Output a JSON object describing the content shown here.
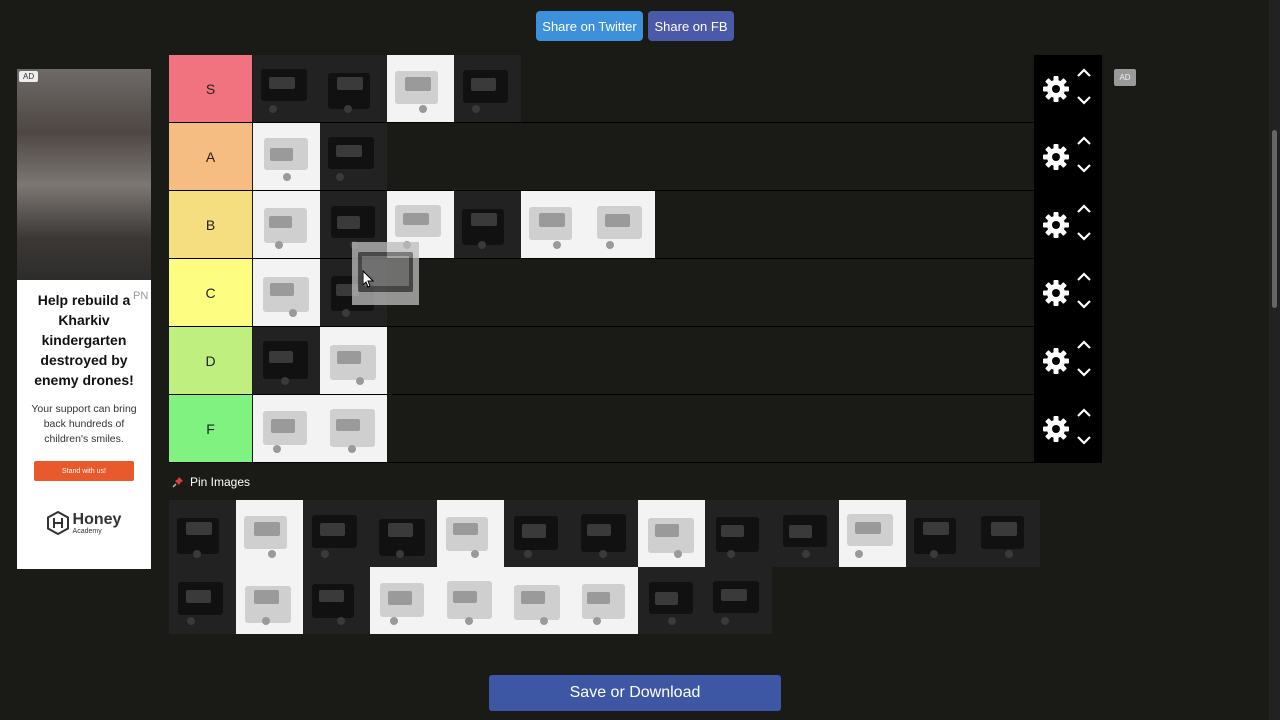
{
  "share": {
    "twitter_label": "Share on Twitter",
    "fb_label": "Share on FB"
  },
  "tiers": [
    {
      "label": "S",
      "color": "#f0737f",
      "items": [
        "dark",
        "dark",
        "light",
        "dark"
      ]
    },
    {
      "label": "A",
      "color": "#f5bd81",
      "items": [
        "light",
        "dark"
      ]
    },
    {
      "label": "B",
      "color": "#f4de7f",
      "items": [
        "light",
        "dark",
        "light",
        "dark",
        "light",
        "light"
      ]
    },
    {
      "label": "C",
      "color": "#fcfd81",
      "items": [
        "light",
        "dark"
      ]
    },
    {
      "label": "D",
      "color": "#bff07f",
      "items": [
        "dark",
        "light"
      ]
    },
    {
      "label": "F",
      "color": "#7ff27f",
      "items": [
        "light",
        "light"
      ]
    }
  ],
  "pin": {
    "label": "Pin Images"
  },
  "pool_items": [
    "dark",
    "light",
    "dark",
    "dark",
    "light",
    "dark",
    "dark",
    "light",
    "dark",
    "dark",
    "light",
    "dark",
    "dark",
    "dark",
    "light",
    "dark",
    "light",
    "light",
    "light",
    "light",
    "dark",
    "dark"
  ],
  "ad": {
    "badge": "AD",
    "headline": "Help rebuild a Kharkiv kindergarten destroyed by enemy drones!",
    "body": "Your support can bring back hundreds of children's smiles.",
    "button": "Stand with us!",
    "logo_name": "Honey",
    "logo_sub": "Academy",
    "pn": "PN",
    "right_badge": "AD"
  },
  "save_label": "Save or Download"
}
